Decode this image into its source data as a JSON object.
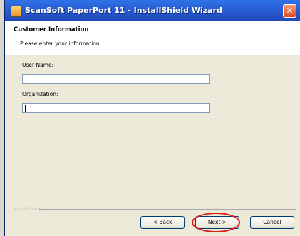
{
  "window": {
    "title": "ScanSoft PaperPort 11 - InstallShield Wizard",
    "close_symbol": "✕"
  },
  "header": {
    "title": "Customer Information",
    "subtitle": "Please enter your information."
  },
  "form": {
    "user_name_mnemonic": "U",
    "user_name_rest": "ser Name:",
    "user_name_value": "",
    "organization_mnemonic": "O",
    "organization_rest": "rganization:",
    "organization_value": ""
  },
  "footer": {
    "brand": "InstallShield",
    "back_label": "< Back",
    "next_label": "Next >",
    "cancel_label": "Cancel"
  },
  "colors": {
    "titlebar": "#2a5fd4",
    "highlight_ring": "#e01b1b",
    "dialog_bg": "#ece9d8"
  },
  "icons": [
    "app-icon",
    "close-icon"
  ]
}
